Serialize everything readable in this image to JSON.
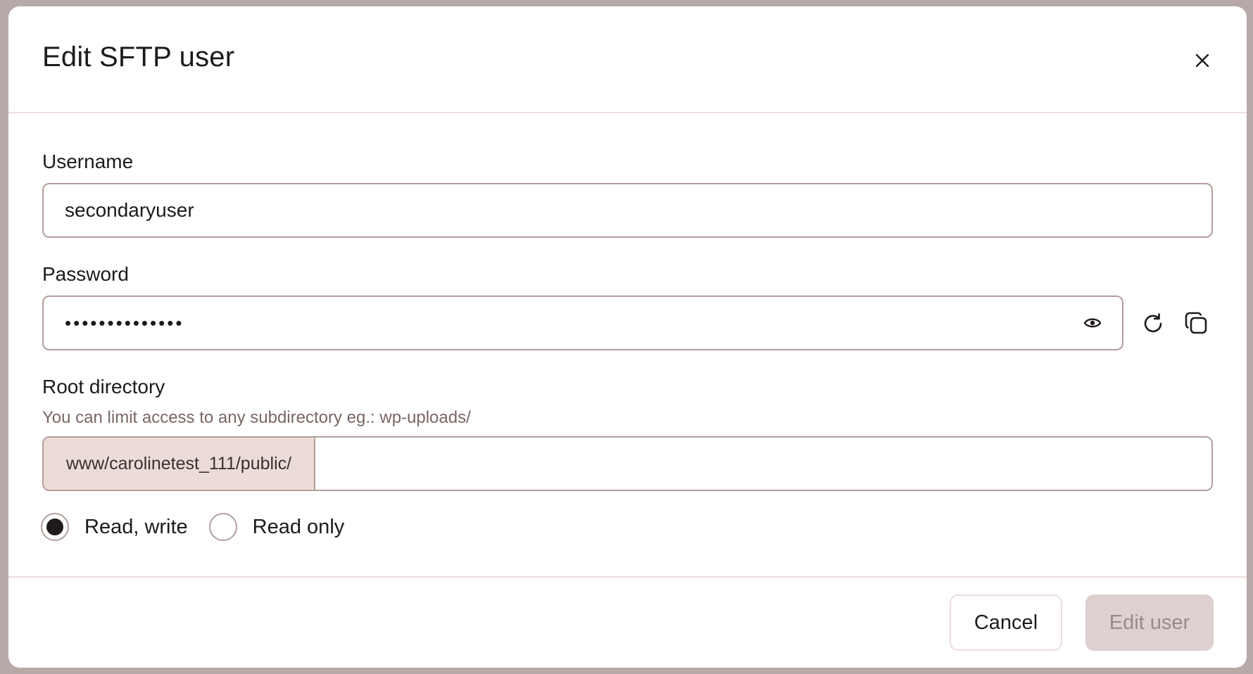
{
  "dialog": {
    "title": "Edit SFTP user"
  },
  "username": {
    "label": "Username",
    "value": "secondaryuser"
  },
  "password": {
    "label": "Password",
    "value": "••••••••••••••"
  },
  "root_directory": {
    "label": "Root directory",
    "hint": "You can limit access to any subdirectory eg.: wp-uploads/",
    "prefix": "www/carolinetest_111/public/",
    "value": ""
  },
  "permissions": {
    "options": [
      "Read, write",
      "Read only"
    ],
    "selected": "Read, write"
  },
  "footer": {
    "cancel_label": "Cancel",
    "submit_label": "Edit user"
  },
  "icons": {
    "close": "close-icon",
    "show_password": "eye-icon",
    "regenerate": "refresh-icon",
    "copy": "copy-icon"
  },
  "colors": {
    "border": "#b49e9b",
    "prefix_bg": "#ecdcd7",
    "disabled_button_bg": "#dcd1cf",
    "disabled_button_text": "#9a8a88",
    "backdrop": "#b6a9a7"
  }
}
